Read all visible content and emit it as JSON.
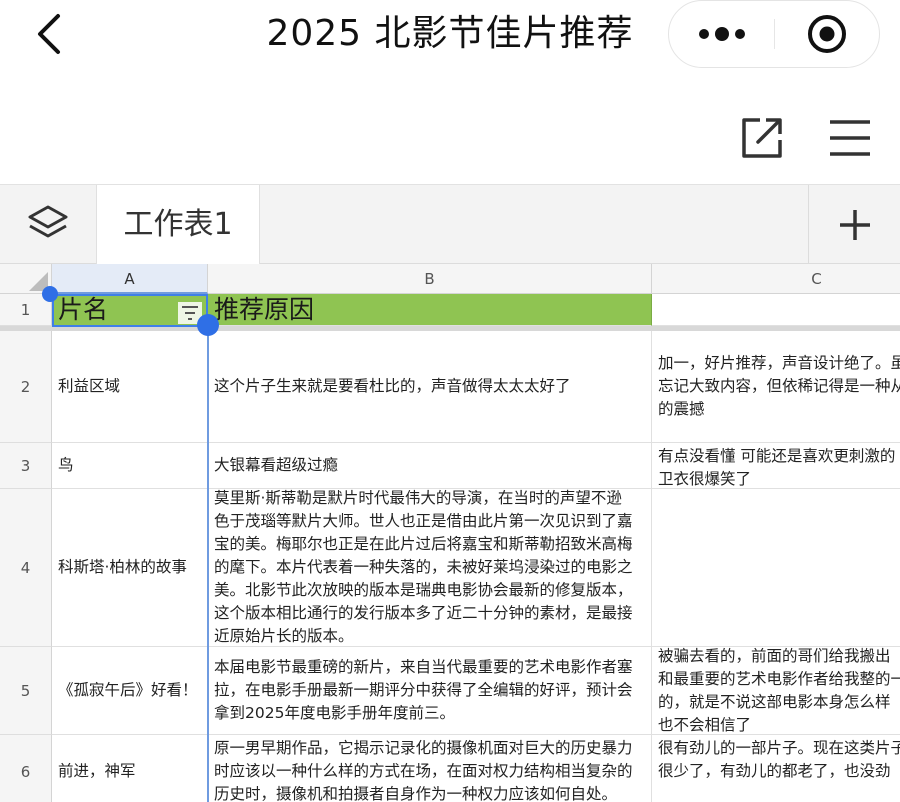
{
  "navbar": {
    "title": "2025 北影节佳片推荐",
    "icons": [
      "chevron-left-icon",
      "more-dots-icon",
      "target-close-icon"
    ]
  },
  "toolbar": {
    "icons": [
      "share-export-icon",
      "hamburger-menu-icon"
    ]
  },
  "sheet_tabs": {
    "active_tab": "工作表1",
    "icons": [
      "layers-icon",
      "plus-icon"
    ]
  },
  "grid": {
    "columns": [
      "A",
      "B",
      "C"
    ],
    "header_row": {
      "row_number": "1",
      "a": "片名",
      "b": "推荐原因",
      "c": ""
    },
    "rows": [
      {
        "row_number": "2",
        "a": "利益区域",
        "b": "这个片子生来就是要看杜比的，声音做得太太太好了",
        "c": "加一，好片推荐，声音设计绝了。虽\n忘记大致内容，但依稀记得是一种从\n的震撼"
      },
      {
        "row_number": "3",
        "a": "鸟",
        "b": "大银幕看超级过瘾",
        "c": "有点没看懂 可能还是喜欢更刺激的\n卫衣很爆笑了"
      },
      {
        "row_number": "4",
        "a": "科斯塔·柏林的故事",
        "b": "莫里斯·斯蒂勒是默片时代最伟大的导演，在当时的声望不逊\n色于茂瑙等默片大师。世人也正是借由此片第一次见识到了嘉\n宝的美。梅耶尔也正是在此片过后将嘉宝和斯蒂勒招致米高梅\n的麾下。本片代表着一种失落的，未被好莱坞浸染过的电影之\n美。北影节此次放映的版本是瑞典电影协会最新的修复版本，\n这个版本相比通行的发行版本多了近二十分钟的素材，是最接\n近原始片长的版本。",
        "c": ""
      },
      {
        "row_number": "5",
        "a": "《孤寂午后》好看！",
        "b": "本届电影节最重磅的新片，来自当代最重要的艺术电影作者塞\n拉，在电影手册最新一期评分中获得了全编辑的好评，预计会\n拿到2025年度电影手册年度前三。",
        "c": "被骗去看的，前面的哥们给我搬出\n和最重要的艺术电影作者给我整的一\n的，就是不说这部电影本身怎么样\n也不会相信了"
      },
      {
        "row_number": "6",
        "a": "前进，神军",
        "b": "原一男早期作品，它揭示记录化的摄像机面对巨大的历史暴力\n时应该以一种什么样的方式在场，在面对权力结构相当复杂的\n历史时，摄像机和拍摄者自身作为一种权力应该如何自处。",
        "c": "很有劲儿的一部片子。现在这类片子\n很少了，有劲儿的都老了，也没劲"
      }
    ]
  },
  "colors": {
    "header_green": "#8fc452",
    "selection_blue": "#3f7fe8"
  }
}
